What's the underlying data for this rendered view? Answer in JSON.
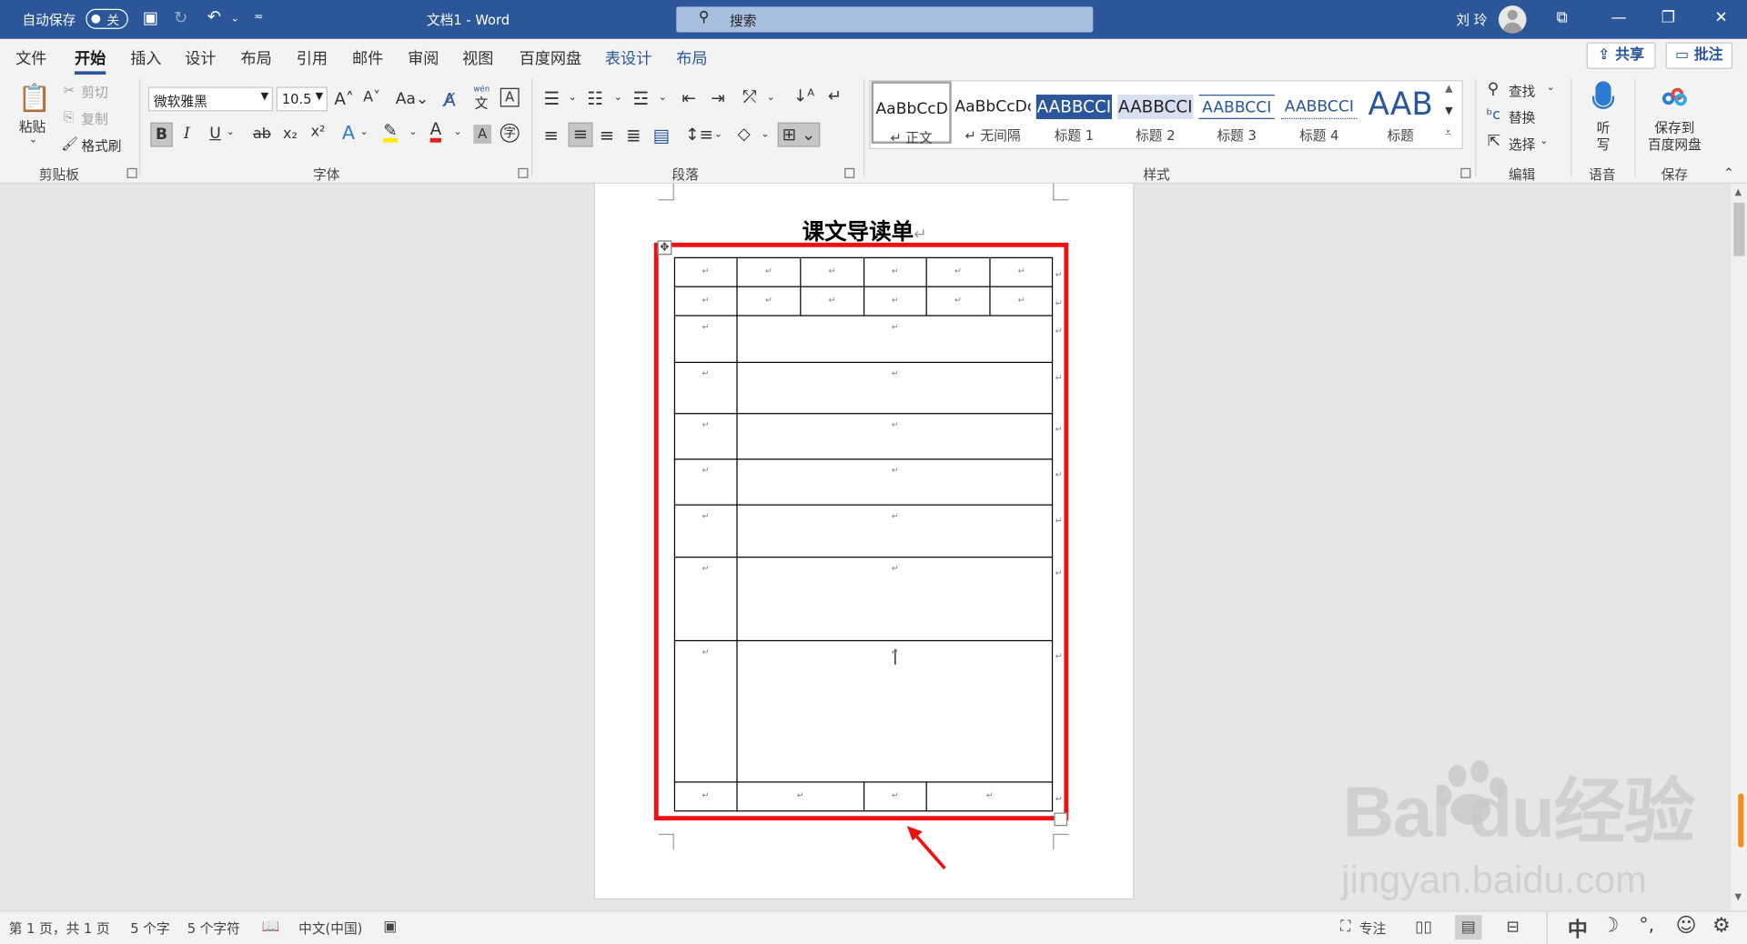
{
  "titlebar": {
    "autosave_label": "自动保存",
    "autosave_state": "关",
    "doc_title": "文档1  -  Word",
    "search_placeholder": "搜索",
    "user_name": "刘 玲"
  },
  "tabs": {
    "items": [
      "文件",
      "开始",
      "插入",
      "设计",
      "布局",
      "引用",
      "邮件",
      "审阅",
      "视图",
      "百度网盘",
      "表设计",
      "布局"
    ],
    "active": "开始",
    "share": "共享",
    "comment": "批注"
  },
  "ribbon": {
    "clipboard": {
      "paste": "粘贴",
      "cut": "剪切",
      "copy": "复制",
      "format_painter": "格式刷",
      "label": "剪贴板"
    },
    "font": {
      "font_name": "微软雅黑",
      "font_size": "10.5",
      "label": "字体",
      "phonetic": "wén"
    },
    "paragraph": {
      "label": "段落"
    },
    "styles": {
      "label": "样式",
      "items": [
        {
          "preview": "AaBbCcDc",
          "name": "↵ 正文"
        },
        {
          "preview": "AaBbCcDc",
          "name": "↵ 无间隔"
        },
        {
          "preview": "AABBCCI",
          "name": "标题 1"
        },
        {
          "preview": "AABBCCI",
          "name": "标题 2"
        },
        {
          "preview": "AABBCCI",
          "name": "标题 3"
        },
        {
          "preview": "AABBCCI",
          "name": "标题 4"
        },
        {
          "preview": "AAB",
          "name": "标题"
        }
      ]
    },
    "editing": {
      "find": "查找",
      "replace": "替换",
      "select": "选择",
      "label": "编辑"
    },
    "voice": {
      "dictate_1": "听",
      "dictate_2": "写",
      "label": "语音"
    },
    "save": {
      "save_1": "保存到",
      "save_2": "百度网盘",
      "label": "保存"
    }
  },
  "document": {
    "title": "课文导读单",
    "return_mark": "↵"
  },
  "status": {
    "page": "第 1 页，共 1 页",
    "words": "5 个字",
    "chars": "5 个字符",
    "language": "中文(中国)",
    "focus": "专注",
    "ime": "中"
  },
  "watermark": {
    "brand": "Bai  du经验",
    "url": "jingyan.baidu.com"
  },
  "colors": {
    "accent": "#2b579a",
    "highlight_box": "#ee1111"
  }
}
